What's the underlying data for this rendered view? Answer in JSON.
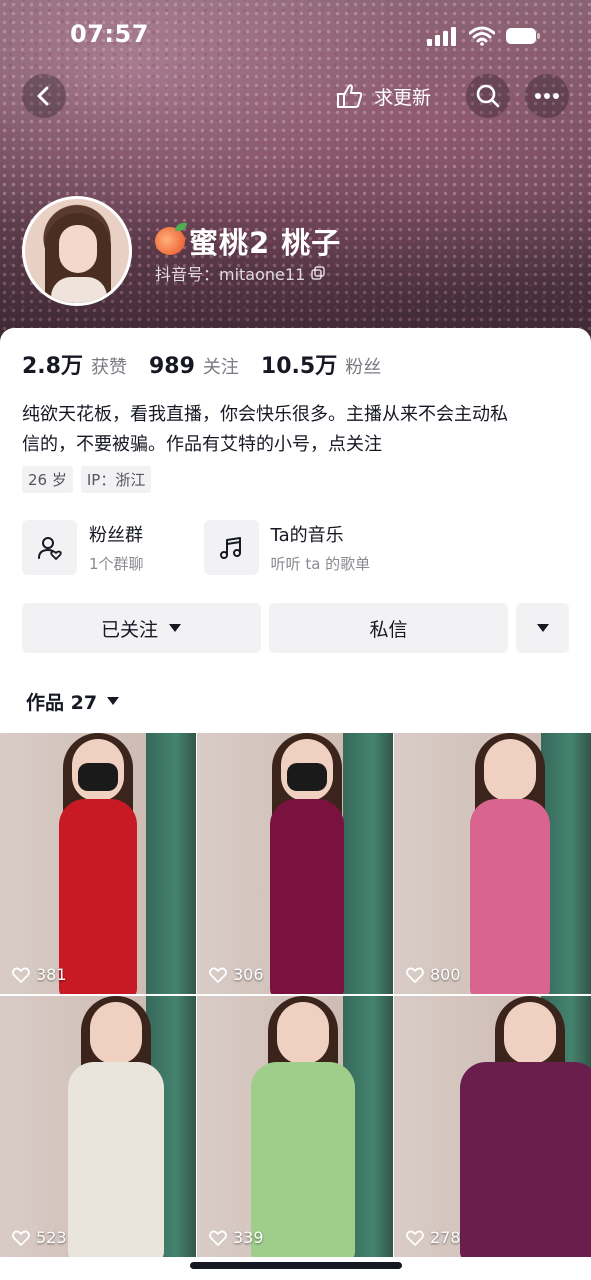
{
  "status_bar": {
    "time": "07:57"
  },
  "nav": {
    "update_label": "求更新"
  },
  "profile": {
    "name": "蜜桃2 桃子",
    "douyin_id": "抖音号：mitaone11",
    "stats": [
      {
        "value": "2.8万",
        "label": "获赞"
      },
      {
        "value": "989",
        "label": "关注"
      },
      {
        "value": "10.5万",
        "label": "粉丝"
      }
    ],
    "bio_line1": "纯欲天花板，看我直播，你会快乐很多。主播从来不会主动私",
    "bio_line2": "信的，不要被骗。作品有艾特的小号，点关注",
    "tags": [
      "26 岁",
      "IP：浙江"
    ]
  },
  "features": [
    {
      "title": "粉丝群",
      "sub": "1个群聊",
      "icon": "fan-group-icon"
    },
    {
      "title": "Ta的音乐",
      "sub": "听听 ta 的歌单",
      "icon": "music-note-icon"
    }
  ],
  "actions": {
    "follow_label": "已关注",
    "message_label": "私信"
  },
  "works": {
    "label": "作品 27",
    "items": [
      {
        "likes": "381",
        "dress": "#c81a24",
        "mask": true
      },
      {
        "likes": "306",
        "dress": "#7a1240",
        "mask": true
      },
      {
        "likes": "800",
        "dress": "#d9658f",
        "mask": false
      },
      {
        "likes": "523",
        "dress": "#e9e4dc",
        "mask": false
      },
      {
        "likes": "339",
        "dress": "#9fce8a",
        "mask": false
      },
      {
        "likes": "278",
        "dress": "#6a1e4b",
        "mask": false
      }
    ]
  }
}
